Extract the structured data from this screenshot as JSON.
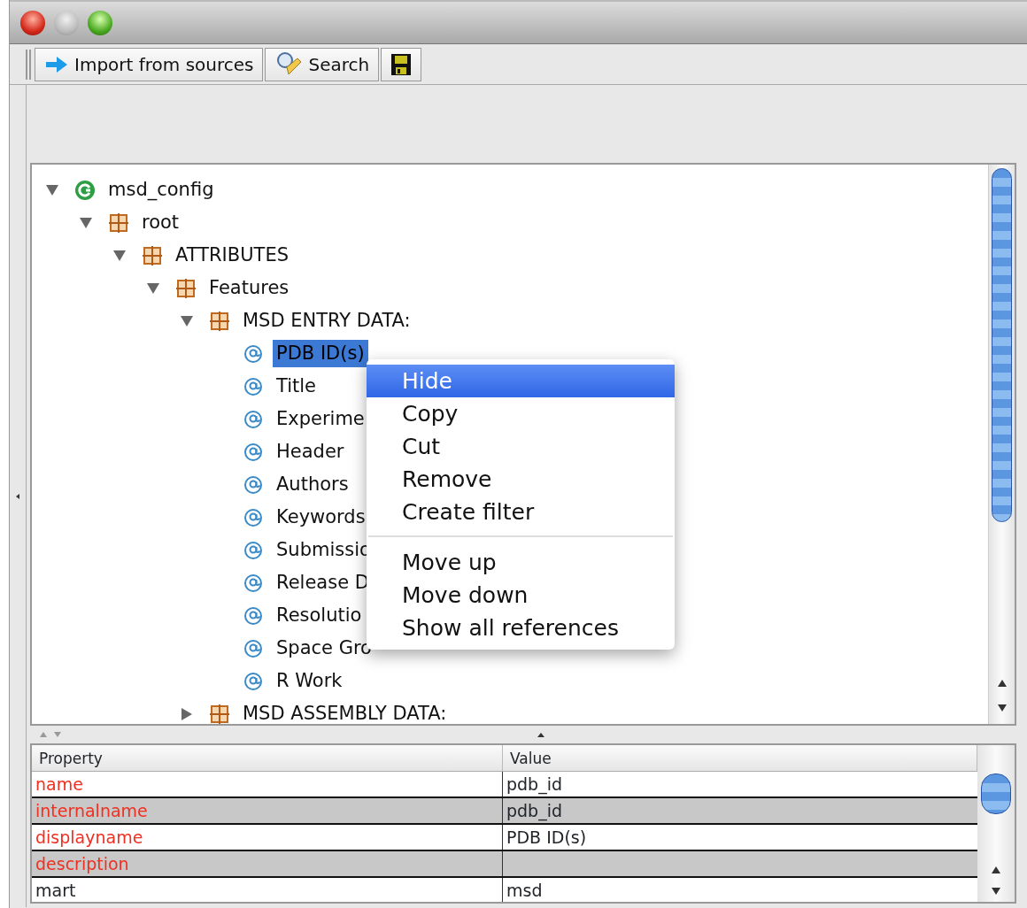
{
  "toolbar": {
    "buttons": [
      {
        "kind": "import",
        "label": "Import from sources"
      },
      {
        "kind": "search",
        "label": "Search"
      },
      {
        "kind": "save"
      }
    ]
  },
  "tree": [
    {
      "kind": "config",
      "label": "msd_config",
      "expanded": true,
      "selected": false,
      "children": [
        {
          "kind": "element",
          "label": "root",
          "expanded": true,
          "selected": false,
          "children": [
            {
              "kind": "element",
              "label": "ATTRIBUTES",
              "expanded": true,
              "selected": false,
              "children": [
                {
                  "kind": "element",
                  "label": "Features",
                  "expanded": true,
                  "selected": false,
                  "children": [
                    {
                      "kind": "element",
                      "label": "MSD ENTRY DATA:",
                      "expanded": true,
                      "selected": false,
                      "children": [
                        {
                          "kind": "attribute",
                          "label": "PDB ID(s)",
                          "selected": true
                        },
                        {
                          "kind": "attribute",
                          "label": "Title",
                          "selected": false
                        },
                        {
                          "kind": "attribute",
                          "label": "Experime",
                          "selected": false
                        },
                        {
                          "kind": "attribute",
                          "label": "Header",
                          "selected": false
                        },
                        {
                          "kind": "attribute",
                          "label": "Authors",
                          "selected": false
                        },
                        {
                          "kind": "attribute",
                          "label": "Keywords",
                          "selected": false
                        },
                        {
                          "kind": "attribute",
                          "label": "Submissio",
                          "selected": false
                        },
                        {
                          "kind": "attribute",
                          "label": "Release D",
                          "selected": false
                        },
                        {
                          "kind": "attribute",
                          "label": "Resolutio",
                          "selected": false
                        },
                        {
                          "kind": "attribute",
                          "label": "Space Gro",
                          "selected": false
                        },
                        {
                          "kind": "attribute",
                          "label": "R Work",
                          "selected": false
                        }
                      ]
                    },
                    {
                      "kind": "element",
                      "label": "MSD ASSEMBLY DATA:",
                      "expanded": false,
                      "selected": false
                    }
                  ]
                }
              ]
            }
          ]
        }
      ]
    }
  ],
  "context_menu": {
    "groups": [
      [
        {
          "label": "Hide",
          "selected": true
        },
        {
          "label": "Copy",
          "selected": false
        },
        {
          "label": "Cut",
          "selected": false
        },
        {
          "label": "Remove",
          "selected": false
        },
        {
          "label": "Create filter",
          "selected": false
        }
      ],
      [
        {
          "label": "Move up",
          "selected": false
        },
        {
          "label": "Move down",
          "selected": false
        },
        {
          "label": "Show all references",
          "selected": false
        }
      ]
    ]
  },
  "properties": {
    "columns": [
      "Property",
      "Value"
    ],
    "rows": [
      {
        "property": "name",
        "value": "pdb_id",
        "required": true
      },
      {
        "property": "internalname",
        "value": "pdb_id",
        "required": true
      },
      {
        "property": "displayname",
        "value": "PDB ID(s)",
        "required": true
      },
      {
        "property": "description",
        "value": "",
        "required": true
      },
      {
        "property": "mart",
        "value": "msd",
        "required": false
      }
    ]
  }
}
